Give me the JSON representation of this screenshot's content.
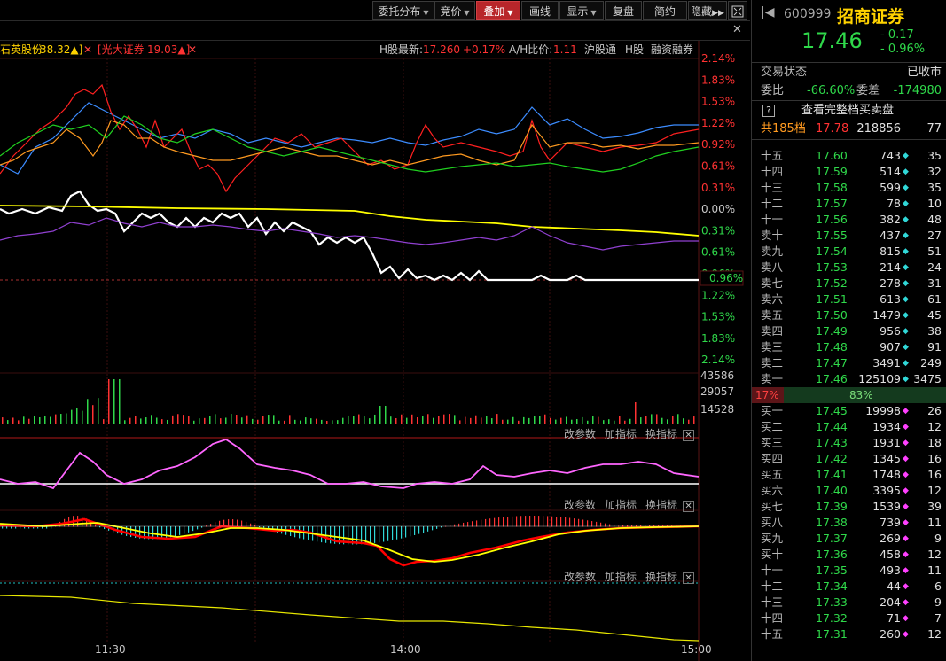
{
  "toolbar": {
    "buttons": [
      {
        "label": "委托分布",
        "caret": true
      },
      {
        "label": "竞价",
        "caret": true
      },
      {
        "label": "叠加",
        "caret": true
      },
      {
        "label": "画线",
        "caret": false
      },
      {
        "label": "显示",
        "caret": true
      },
      {
        "label": "复盘",
        "caret": false
      },
      {
        "label": "简约",
        "caret": false
      },
      {
        "label": "隐藏",
        "caret": false
      }
    ],
    "active_button": "叠加",
    "overflow_icon": "double-chevron-right-icon",
    "window_icon": "maximize-icon"
  },
  "overlay_bar": {
    "stock1_label": "石英股份",
    "stock1_value": "38.32▲]",
    "stock2_label": "[光大证券",
    "stock2_value": "19.03▲]",
    "hshare_label": "H股最新:",
    "hshare_price": "17.260",
    "hshare_change": "+0.17%",
    "ah_label": "A/H比价:",
    "ah_value": "1.11",
    "link1": "沪股通",
    "link2": "H股",
    "link3": "融资融券"
  },
  "chart": {
    "right_axis_pct": [
      "2.14%",
      "1.83%",
      "1.53%",
      "1.22%",
      "0.92%",
      "0.61%",
      "0.31%",
      "0.00%",
      "0.31%",
      "0.61%",
      "0.96%",
      "1.22%",
      "1.53%",
      "1.83%",
      "2.14%"
    ],
    "volume_axis": [
      "43586",
      "29057",
      "14528"
    ],
    "time_labels": [
      "11:30",
      "14:00",
      "15:00"
    ],
    "current_marker": "0.96%",
    "panel_controls": {
      "params": "改参数",
      "add": "加指标",
      "switch": "换指标"
    }
  },
  "colors": {
    "up": "#ff3232",
    "down": "#2fd84a",
    "price_line": "#ffffff",
    "avg_line": "#ffff00",
    "accent_yellow": "#ffd200"
  },
  "quote": {
    "code": "600999",
    "name": "招商证券",
    "price": "17.46",
    "change": "- 0.17",
    "change_pct": "- 0.96%",
    "status_label": "交易状态",
    "status_value": "已收市",
    "weibi_label": "委比",
    "weibi_value": "-66.60%",
    "weicha_label": "委差",
    "weicha_value": "-174980",
    "full_book_link": "查看完整档买卖盘",
    "total_label": "共185档",
    "total_price": "17.78",
    "total_vol": "218856",
    "total_cnt": "77",
    "ratio_sell_pct": "17%",
    "ratio_buy_pct": "83%",
    "sell_ratio": 0.17,
    "asks": [
      {
        "label": "十五",
        "price": "17.60",
        "vol": "743",
        "cnt": "35"
      },
      {
        "label": "十四",
        "price": "17.59",
        "vol": "514",
        "cnt": "32"
      },
      {
        "label": "十三",
        "price": "17.58",
        "vol": "599",
        "cnt": "35"
      },
      {
        "label": "十二",
        "price": "17.57",
        "vol": "78",
        "cnt": "10"
      },
      {
        "label": "十一",
        "price": "17.56",
        "vol": "382",
        "cnt": "48"
      },
      {
        "label": "卖十",
        "price": "17.55",
        "vol": "437",
        "cnt": "27"
      },
      {
        "label": "卖九",
        "price": "17.54",
        "vol": "815",
        "cnt": "51"
      },
      {
        "label": "卖八",
        "price": "17.53",
        "vol": "214",
        "cnt": "24"
      },
      {
        "label": "卖七",
        "price": "17.52",
        "vol": "278",
        "cnt": "31"
      },
      {
        "label": "卖六",
        "price": "17.51",
        "vol": "613",
        "cnt": "61"
      },
      {
        "label": "卖五",
        "price": "17.50",
        "vol": "1479",
        "cnt": "45"
      },
      {
        "label": "卖四",
        "price": "17.49",
        "vol": "956",
        "cnt": "38"
      },
      {
        "label": "卖三",
        "price": "17.48",
        "vol": "907",
        "cnt": "91"
      },
      {
        "label": "卖二",
        "price": "17.47",
        "vol": "3491",
        "cnt": "249"
      },
      {
        "label": "卖一",
        "price": "17.46",
        "vol": "125109",
        "cnt": "3475"
      }
    ],
    "bids": [
      {
        "label": "买一",
        "price": "17.45",
        "vol": "19998",
        "cnt": "26"
      },
      {
        "label": "买二",
        "price": "17.44",
        "vol": "1934",
        "cnt": "12"
      },
      {
        "label": "买三",
        "price": "17.43",
        "vol": "1931",
        "cnt": "18"
      },
      {
        "label": "买四",
        "price": "17.42",
        "vol": "1345",
        "cnt": "16"
      },
      {
        "label": "买五",
        "price": "17.41",
        "vol": "1748",
        "cnt": "16"
      },
      {
        "label": "买六",
        "price": "17.40",
        "vol": "3395",
        "cnt": "12"
      },
      {
        "label": "买七",
        "price": "17.39",
        "vol": "1539",
        "cnt": "39"
      },
      {
        "label": "买八",
        "price": "17.38",
        "vol": "739",
        "cnt": "11"
      },
      {
        "label": "买九",
        "price": "17.37",
        "vol": "269",
        "cnt": "9"
      },
      {
        "label": "买十",
        "price": "17.36",
        "vol": "458",
        "cnt": "12"
      },
      {
        "label": "十一",
        "price": "17.35",
        "vol": "493",
        "cnt": "11"
      },
      {
        "label": "十二",
        "price": "17.34",
        "vol": "44",
        "cnt": "6"
      },
      {
        "label": "十三",
        "price": "17.33",
        "vol": "204",
        "cnt": "9"
      },
      {
        "label": "十四",
        "price": "17.32",
        "vol": "71",
        "cnt": "7"
      },
      {
        "label": "十五",
        "price": "17.31",
        "vol": "260",
        "cnt": "12"
      }
    ]
  }
}
